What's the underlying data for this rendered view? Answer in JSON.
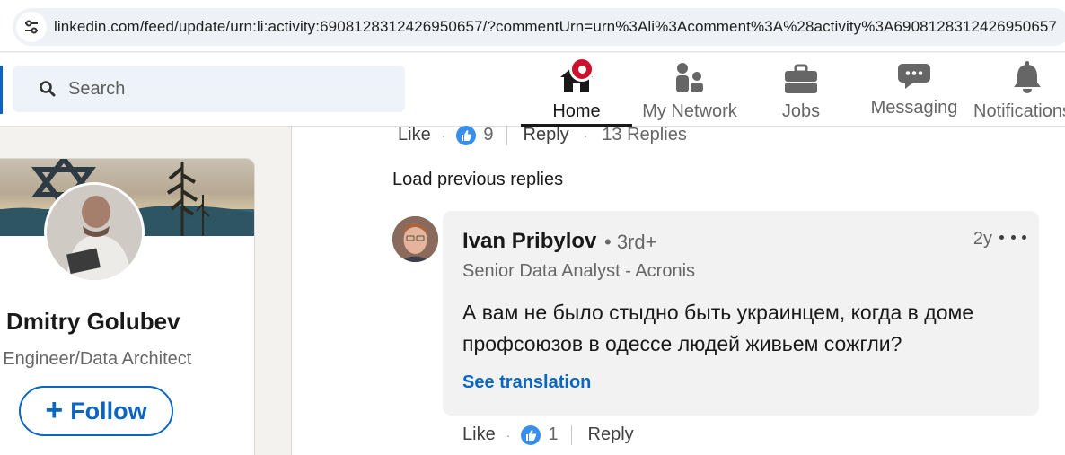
{
  "browser": {
    "url": "linkedin.com/feed/update/urn:li:activity:6908128312426950657/?commentUrn=urn%3Ali%3Acomment%3A%28activity%3A6908128312426950657"
  },
  "search": {
    "placeholder": "Search"
  },
  "nav": [
    {
      "label": "Home",
      "icon": "home-icon",
      "active": true,
      "badge": true
    },
    {
      "label": "My Network",
      "icon": "network-icon"
    },
    {
      "label": "Jobs",
      "icon": "briefcase-icon"
    },
    {
      "label": "Messaging",
      "icon": "messaging-icon"
    },
    {
      "label": "Notifications",
      "icon": "bell-icon"
    }
  ],
  "profile": {
    "name": "Dmitry Golubev",
    "headline": "ta Engineer/Data Architect",
    "follow_label": "Follow"
  },
  "parent_comment_actions": {
    "like": "Like",
    "like_count": "9",
    "reply": "Reply",
    "replies": "13 Replies"
  },
  "load_previous": "Load previous replies",
  "comment": {
    "author": "Ivan Pribylov",
    "degree": "• 3rd+",
    "time": "2y",
    "title": "Senior Data Analyst - Acronis",
    "text": "А вам не было стыдно быть украинцем, когда в доме профсоюзов в одессе людей живьем сожгли?",
    "translate": "See translation"
  },
  "comment_actions": {
    "like": "Like",
    "like_count": "1",
    "reply": "Reply"
  },
  "colors": {
    "brand": "#0a66c2",
    "badge": "#cb112d",
    "reaction": "#378fe9"
  }
}
